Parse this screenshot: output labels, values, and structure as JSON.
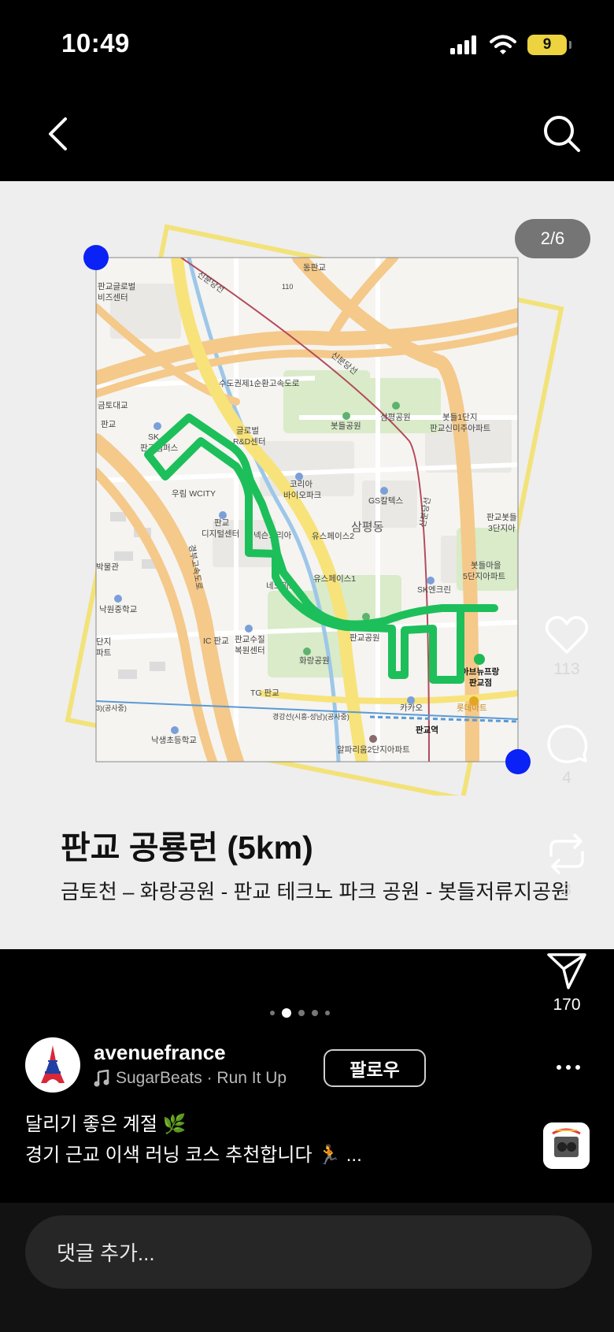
{
  "status_bar": {
    "time": "10:49",
    "battery": "9",
    "icons": [
      "signal-icon",
      "wifi-icon",
      "battery-icon"
    ],
    "battery_color": "#ECD33F"
  },
  "nav": {
    "back_icon": "chevron-left-icon",
    "search_icon": "search-icon"
  },
  "post": {
    "page_indicator": "2/6",
    "title": "판교 공룡런 (5km)",
    "subtitle": "금토천 – 화랑공원 - 판교 테크노 파크 공원 - 봇들저류지공원",
    "carousel_dots": 5,
    "carousel_active": 1
  },
  "map": {
    "route_color": "#1DBF5A",
    "frame_color": "#F2E27A",
    "handle_color": "#0A22F5",
    "labels": {
      "sinbundang1": "신분당선",
      "sinbundang2": "신분당선",
      "sinbundang3": "신분당선",
      "dongpangyo": "동판교",
      "exit110": "110",
      "pangyo_global": "판교글로벌",
      "biz_center": "비즈센터",
      "sudogwon": "수도권제1순환고속도로",
      "geumto_bridge": "금토대교",
      "pangyo_left": "판교",
      "sk_campus1": "SK",
      "sk_campus2": "판교캠퍼스",
      "global_rnd1": "글로벌",
      "global_rnd2": "R&D센터",
      "botdeul_park": "봇들공원",
      "sampyeong_park": "삼평공원",
      "botdeul1_a": "봇들1단지",
      "botdeul1_b": "판교신미주아파트",
      "woorim": "우림 WCITY",
      "korea_bio1": "코리아",
      "korea_bio2": "바이오파크",
      "gs_caltex": "GS칼텍스",
      "sampyeong_dong": "삼평동",
      "pangyo_botdeul3_a": "판교봇들",
      "pangyo_botdeul3_b": "3단지아",
      "digital1": "판교",
      "digital2": "디지털센터",
      "nexon": "넥슨코리아",
      "ues2": "유스페이스2",
      "gyeongbu": "경부고속도로",
      "museum": "박물관",
      "botdeul5_a": "봇들마을",
      "botdeul5_b": "5단지아파트",
      "neowiz": "네오위즈",
      "ues1": "유스페이스1",
      "sk_encrin": "SK엔크린",
      "nakwon_middle": "낙원중학교",
      "pangyo_park": "판교공원",
      "apt_left1": "단지",
      "apt_left2": "파트",
      "ic_pangyo": "IC 판교",
      "water1": "판교수질",
      "water2": "복원센터",
      "hwarang": "화랑공원",
      "avenue1": "아브뉴프랑",
      "avenue2": "판교점",
      "tg_pangyo": "TG 판교",
      "kakao": "카카오",
      "lotte": "롯데마트",
      "gyeonggang_left": "3)(공사중)",
      "gyeonggang": "경강선(시흥-성남)(공사중)",
      "pangyo_station": "판교역",
      "naksaeng": "낙생초등학교",
      "alpharium": "알파리움2단지아파트"
    }
  },
  "actions": {
    "like": {
      "icon": "heart-icon",
      "count": "113"
    },
    "comment": {
      "icon": "comment-icon",
      "count": "4"
    },
    "repost": {
      "icon": "repost-icon",
      "count": "3"
    },
    "share": {
      "icon": "send-icon",
      "count": "170"
    }
  },
  "author": {
    "username": "avenuefrance",
    "music": "SugarBeats · Run It Up",
    "music_icon": "music-note-icon",
    "follow_label": "팔로우",
    "avatar_icon": "eiffel-tower-logo-icon"
  },
  "caption": {
    "line1": "달리기 좋은 계절 🌿",
    "line2": "경기 근교 이색 러닝 코스 추천합니다 🏃 ..."
  },
  "comment": {
    "placeholder": "댓글 추가..."
  }
}
